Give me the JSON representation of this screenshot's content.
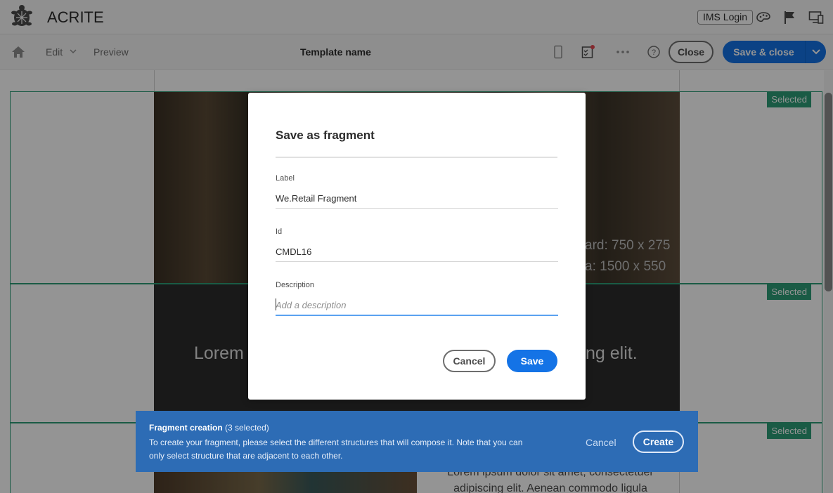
{
  "header": {
    "app_title": "ACRITE",
    "ims_login": "IMS Login",
    "icons": [
      "turtle-logo",
      "palette-icon",
      "flag-icon",
      "devices-icon"
    ]
  },
  "toolbar": {
    "edit": "Edit",
    "preview": "Preview",
    "template_name": "Template name",
    "close": "Close",
    "save_close": "Save & close",
    "icons": [
      "home-icon",
      "mobile-icon",
      "checklist-icon",
      "more-icon",
      "help-icon",
      "chevron-down-icon"
    ]
  },
  "canvas": {
    "selected_badge": "Selected",
    "image_text_1": "ard: 750 x 275",
    "image_text_2": "a: 1500 x 550",
    "headline_left": "Lorem",
    "headline_right": "ng elit.",
    "body_text": "Lorem ipsum dolor sit amet, consectetuer adipiscing elit. Aenean commodo ligula"
  },
  "dialog": {
    "title": "Save as fragment",
    "label_field": {
      "label": "Label",
      "value": "We.Retail Fragment"
    },
    "id_field": {
      "label": "Id",
      "value": "CMDL16"
    },
    "description_field": {
      "label": "Description",
      "placeholder": "Add a description"
    },
    "cancel": "Cancel",
    "save": "Save"
  },
  "toast": {
    "title": "Fragment creation",
    "count": "(3 selected)",
    "body": "To create your fragment, please select the different structures that will compose it. Note that you can only select structure that are adjacent to each other.",
    "cancel": "Cancel",
    "create": "Create"
  },
  "colors": {
    "accent": "#1473e6",
    "selected_green": "#2d9d78",
    "toast_bg": "#2d6cb5"
  }
}
